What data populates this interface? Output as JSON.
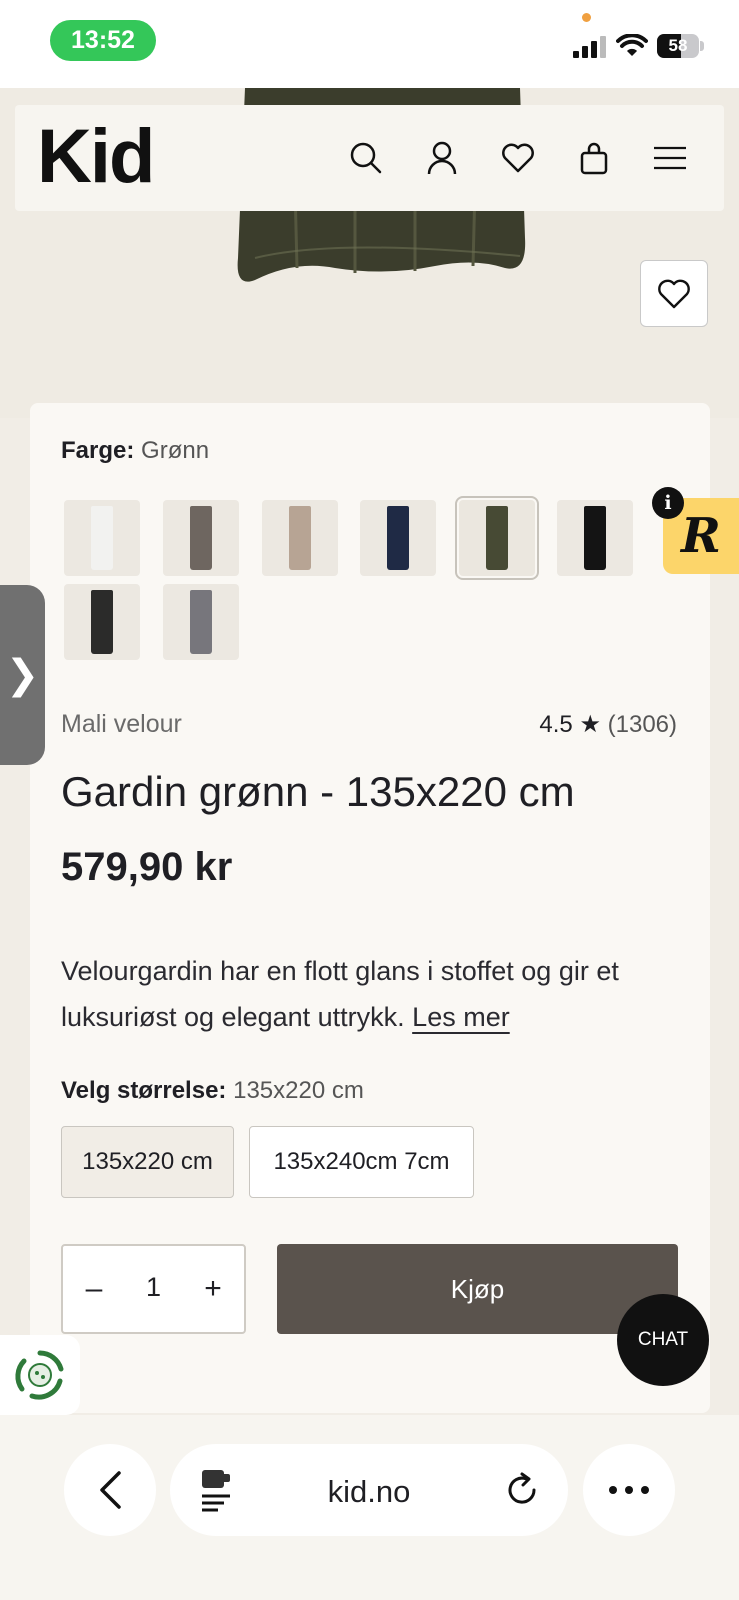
{
  "status_bar": {
    "time": "13:52",
    "battery": "58",
    "battery_level_percent": 58
  },
  "header": {
    "logo": "Kid",
    "icons": [
      "search-icon",
      "account-icon",
      "wishlist-icon",
      "cart-icon",
      "menu-icon"
    ]
  },
  "product": {
    "color_label": "Farge:",
    "color_value": "Grønn",
    "swatches": [
      {
        "color": "#f2f2f0",
        "selected": false
      },
      {
        "color": "#6e6660",
        "selected": false
      },
      {
        "color": "#b7a494",
        "selected": false
      },
      {
        "color": "#1f2a45",
        "selected": false
      },
      {
        "color": "#474a34",
        "selected": true
      },
      {
        "color": "#141414",
        "selected": false
      },
      {
        "color": "#2b2b2a",
        "selected": false
      },
      {
        "color": "#77767c",
        "selected": false
      }
    ],
    "brand": "Mali velour",
    "rating": "4.5 ★",
    "rating_count": "(1306)",
    "title": "Gardin grønn - 135x220 cm",
    "price": "579,90 kr",
    "description": "Velourgardin har en flott glans i stoffet og gir et luksuriøst og elegant uttrykk.",
    "read_more": "Les mer",
    "size_label": "Velg størrelse:",
    "size_value": "135x220 cm",
    "sizes": [
      "135x220 cm",
      "135x240cm 7cm"
    ],
    "quantity": "1",
    "buy_label": "Kjøp"
  },
  "overlays": {
    "side_tab": "❯",
    "reviews_badge": "R",
    "info": "i",
    "chat": "CHAT"
  },
  "browser": {
    "url": "kid.no"
  }
}
